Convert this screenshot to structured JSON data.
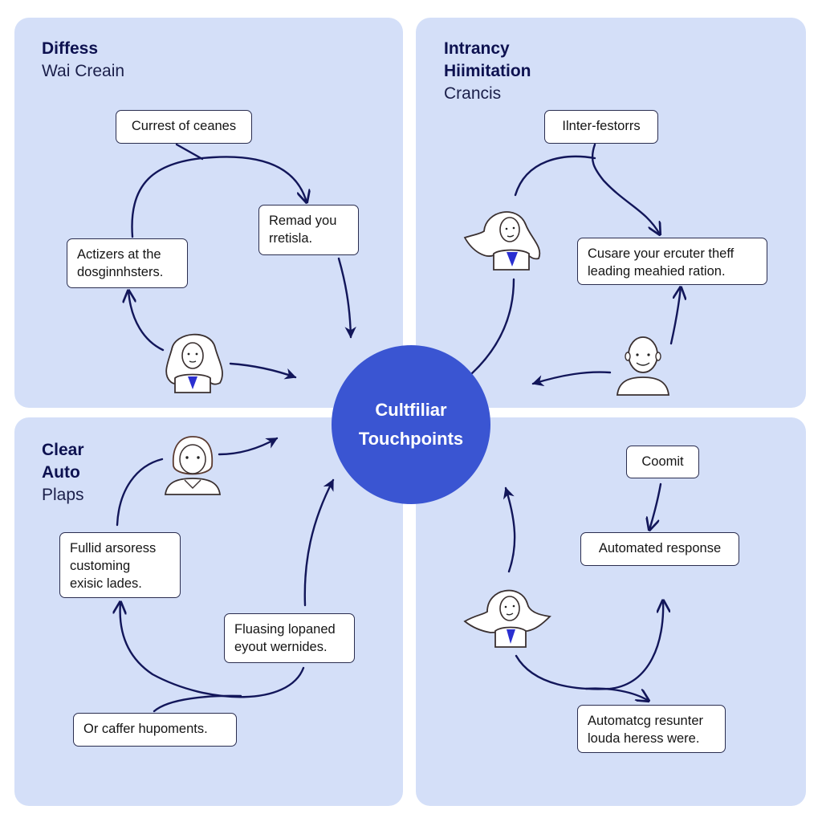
{
  "hub": {
    "line1": "Cultfiliar",
    "line2": "Touchpoints",
    "color": "#3a55d2"
  },
  "colors": {
    "panel_bg": "#d4dff8",
    "arrow": "#12165a",
    "accent_tie": "#2a2fd0"
  },
  "quadrants": {
    "top_left": {
      "heading_bold": [
        "Diffess"
      ],
      "heading_regular": [
        "Wai Creain"
      ],
      "boxes": {
        "top": "Currest of ceanes",
        "right": "Remad you\nrretisla.",
        "left": "Actizers at the\ndosginnhsters."
      },
      "avatar": "woman-long-hair-avatar"
    },
    "top_right": {
      "heading_bold": [
        "Intrancy",
        "Hiimitation"
      ],
      "heading_regular": [
        "Crancis"
      ],
      "boxes": {
        "top": "Ilnter-festorrs",
        "right": "Cusare your ercuter theff\nleading meahied ration."
      },
      "avatars": [
        "woman-flowing-hair-avatar",
        "bald-man-avatar"
      ]
    },
    "bottom_left": {
      "heading_bold": [
        "Clear",
        "Auto"
      ],
      "heading_regular": [
        "Plaps"
      ],
      "boxes": {
        "left": "Fullid arsoress\ncustoming\nexisic lades.",
        "right": "Fluasing lopaned\neyout wernides.",
        "bottom": "Or caffer hupoments."
      },
      "avatar": "hooded-person-avatar"
    },
    "bottom_right": {
      "boxes": {
        "top": "Coomit",
        "middle": "Automated response",
        "bottom": "Automatcg resunter\nlouda heress were."
      },
      "avatar": "woman-winged-hair-avatar"
    }
  }
}
